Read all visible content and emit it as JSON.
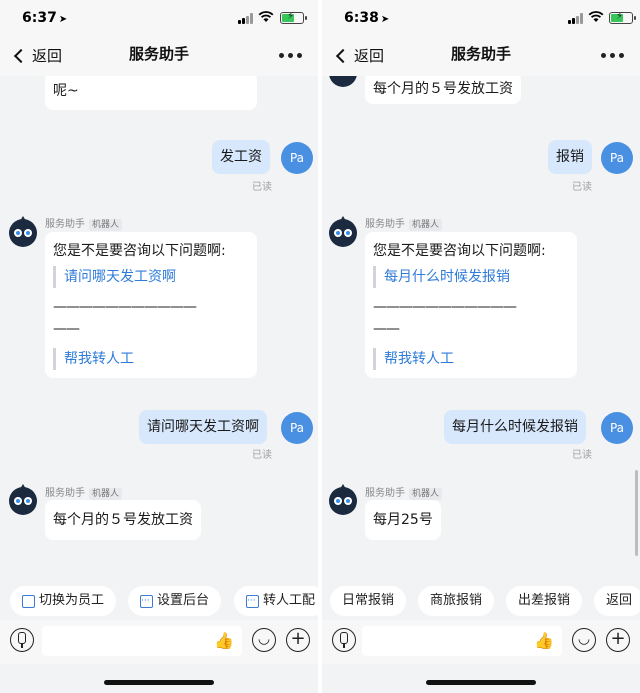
{
  "screens": [
    {
      "time": "6:37",
      "back_label": "返回",
      "title": "服务助手",
      "partial_text": "呢~",
      "user_msg_1": "发工资",
      "read_1": "已读",
      "bot_name": "服务助手",
      "bot_tag": "机器人",
      "bot_prompt": "您是不是要咨询以下问题啊:",
      "bot_option_1": "请问哪天发工资啊",
      "divider_1": "———————————",
      "divider_2": "——",
      "bot_option_2": "帮我转人工",
      "user_msg_2": "请问哪天发工资啊",
      "read_2": "已读",
      "bot_name_2": "服务助手",
      "bot_tag_2": "机器人",
      "bot_reply": "每个月的５号发放工资",
      "user_avatar": "Pa",
      "chips": [
        "切换为员工",
        "设置后台",
        "转人工配"
      ]
    },
    {
      "time": "6:38",
      "back_label": "返回",
      "title": "服务助手",
      "partial_text": "每个月的５号发放工资",
      "user_msg_1": "报销",
      "read_1": "已读",
      "bot_name": "服务助手",
      "bot_tag": "机器人",
      "bot_prompt": "您是不是要咨询以下问题啊:",
      "bot_option_1": "每月什么时候发报销",
      "divider_1": "———————————",
      "divider_2": "——",
      "bot_option_2": "帮我转人工",
      "user_msg_2": "每月什么时候发报销",
      "read_2": "已读",
      "bot_name_2": "服务助手",
      "bot_tag_2": "机器人",
      "bot_reply": "每月25号",
      "user_avatar": "Pa",
      "chips": [
        "日常报销",
        "商旅报销",
        "出差报销",
        "返回"
      ]
    }
  ],
  "colors": {
    "user_bubble": "#d7e7fc",
    "link": "#2f7bd9",
    "avatar": "#4a90e2",
    "battery": "#36c65a"
  },
  "icons": [
    "location-arrow-icon",
    "signal-icon",
    "wifi-icon",
    "battery-icon",
    "chevron-left-icon",
    "more-icon",
    "robot-avatar-icon",
    "switch-icon",
    "grid-icon",
    "mic-icon",
    "thumbs-up-icon",
    "emoji-icon",
    "plus-icon"
  ]
}
